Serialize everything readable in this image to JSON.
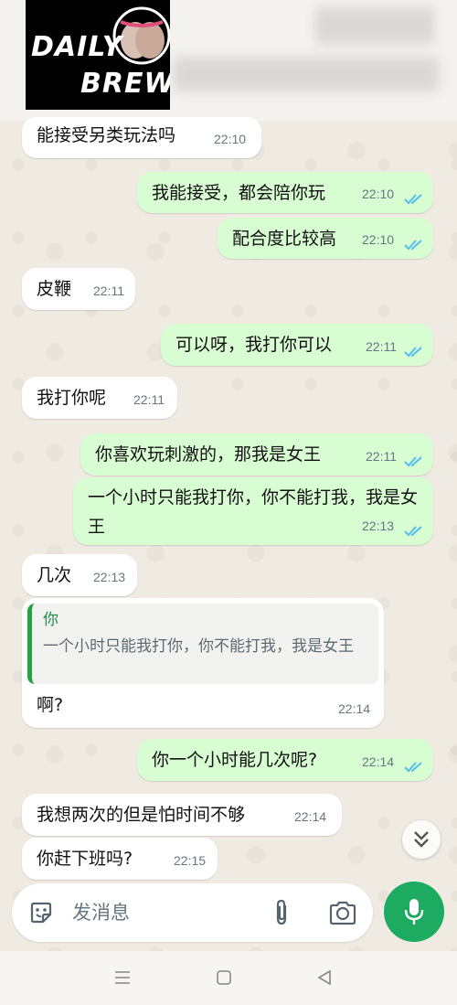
{
  "header": {
    "logo_line1": "DAILY",
    "logo_line2": "BREW"
  },
  "messages": [
    {
      "dir": "in",
      "text": "能接受另类玩法吗",
      "time": "22:10"
    },
    {
      "dir": "out",
      "text": "我能接受，都会陪你玩",
      "time": "22:10",
      "read": true
    },
    {
      "dir": "out",
      "text": "配合度比较高",
      "time": "22:10",
      "read": true
    },
    {
      "dir": "in",
      "text": "皮鞭",
      "time": "22:11"
    },
    {
      "dir": "out",
      "text": "可以呀，我打你可以",
      "time": "22:11",
      "read": true
    },
    {
      "dir": "in",
      "text": "我打你呢",
      "time": "22:11"
    },
    {
      "dir": "out",
      "text": "你喜欢玩刺激的，那我是女王",
      "time": "22:11",
      "read": true
    },
    {
      "dir": "out",
      "text": "一个小时只能我打你，你不能打我，我是女王",
      "time": "22:13",
      "read": true
    },
    {
      "dir": "in",
      "text": "几次",
      "time": "22:13"
    },
    {
      "dir": "in",
      "text": "啊?",
      "time": "22:14",
      "quote": {
        "name": "你",
        "text": "一个小时只能我打你，你不能打我，我是女王"
      }
    },
    {
      "dir": "out",
      "text": "你一个小时能几次呢?",
      "time": "22:14",
      "read": true
    },
    {
      "dir": "in",
      "text": "我想两次的但是怕时间不够",
      "time": "22:14"
    },
    {
      "dir": "in",
      "text": "你赶下班吗?",
      "time": "22:15"
    }
  ],
  "composer": {
    "placeholder": "发消息",
    "icons": [
      "sticker-icon",
      "attach-icon",
      "camera-icon",
      "mic-icon"
    ]
  },
  "scroll_down_icon": "double-chevron-down-icon",
  "navbar": {
    "icons": [
      "menu-icon",
      "home-icon",
      "back-icon"
    ]
  },
  "colors": {
    "outgoing_bubble": "#d9fdd3",
    "incoming_bubble": "#ffffff",
    "read_ticks": "#53bdeb",
    "mic_button": "#1daa61",
    "quote_bar": "#25a244"
  }
}
